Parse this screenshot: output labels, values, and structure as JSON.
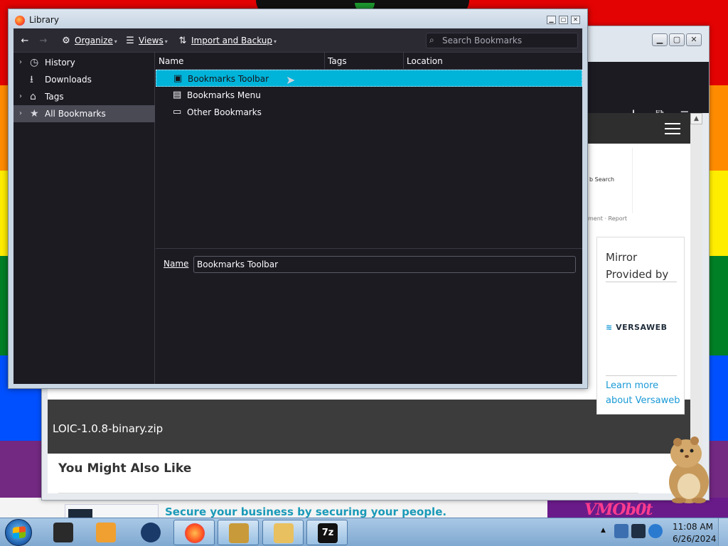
{
  "library": {
    "title": "Library",
    "toolbar": {
      "organize": "Organize",
      "views": "Views",
      "import_backup": "Import and Backup",
      "search_placeholder": "Search Bookmarks"
    },
    "sidebar": [
      {
        "label": "History",
        "icon": "clock-icon",
        "twisty": true,
        "selected": false
      },
      {
        "label": "Downloads",
        "icon": "download-icon",
        "twisty": false,
        "selected": false
      },
      {
        "label": "Tags",
        "icon": "tags-icon",
        "twisty": true,
        "selected": false
      },
      {
        "label": "All Bookmarks",
        "icon": "star-icon",
        "twisty": true,
        "selected": true
      }
    ],
    "columns": [
      "Name",
      "Tags",
      "Location"
    ],
    "rows": [
      {
        "label": "Bookmarks Toolbar",
        "icon": "toolbar-icon",
        "selected": true
      },
      {
        "label": "Bookmarks Menu",
        "icon": "menu-icon",
        "selected": false
      },
      {
        "label": "Other Bookmarks",
        "icon": "folder-icon",
        "selected": false
      }
    ],
    "details": {
      "name_label": "Name",
      "name_value": "Bookmarks Toolbar"
    }
  },
  "browser_page": {
    "ad_text": "b Search",
    "ad_report": "ment · Report",
    "download_file": "LOIC-1.0.8-binary.zip",
    "mirror_title": "Mirror Provided by",
    "mirror_logo": "VERSAWEB",
    "mirror_link": "Learn more about Versaweb",
    "also_like": "You Might Also Like",
    "promo_link": "Secure your business by securing your people."
  },
  "desktop": {
    "vmo_text": "VMOb0t"
  },
  "taskbar": {
    "time": "11:08 AM",
    "date": "6/26/2024",
    "apps": [
      {
        "name": "terminal-app",
        "color": "#2a2a2a",
        "active": false
      },
      {
        "name": "media-player-app",
        "color": "#f0a030",
        "active": false
      },
      {
        "name": "globe-app",
        "color": "#1a3a6a",
        "active": false
      },
      {
        "name": "firefox-app",
        "color": "#ff7a1a",
        "active": true
      },
      {
        "name": "sandbox-app",
        "color": "#c89a3a",
        "active": true
      },
      {
        "name": "mail-app",
        "color": "#e8c060",
        "active": true
      },
      {
        "name": "7zip-app",
        "color": "#111111",
        "active": true
      }
    ]
  },
  "colors": {
    "selection": "#00b3d9",
    "dark_bg": "#1c1b22",
    "toolbar_bg": "#2b2a33",
    "link_blue": "#1a9ad6"
  }
}
